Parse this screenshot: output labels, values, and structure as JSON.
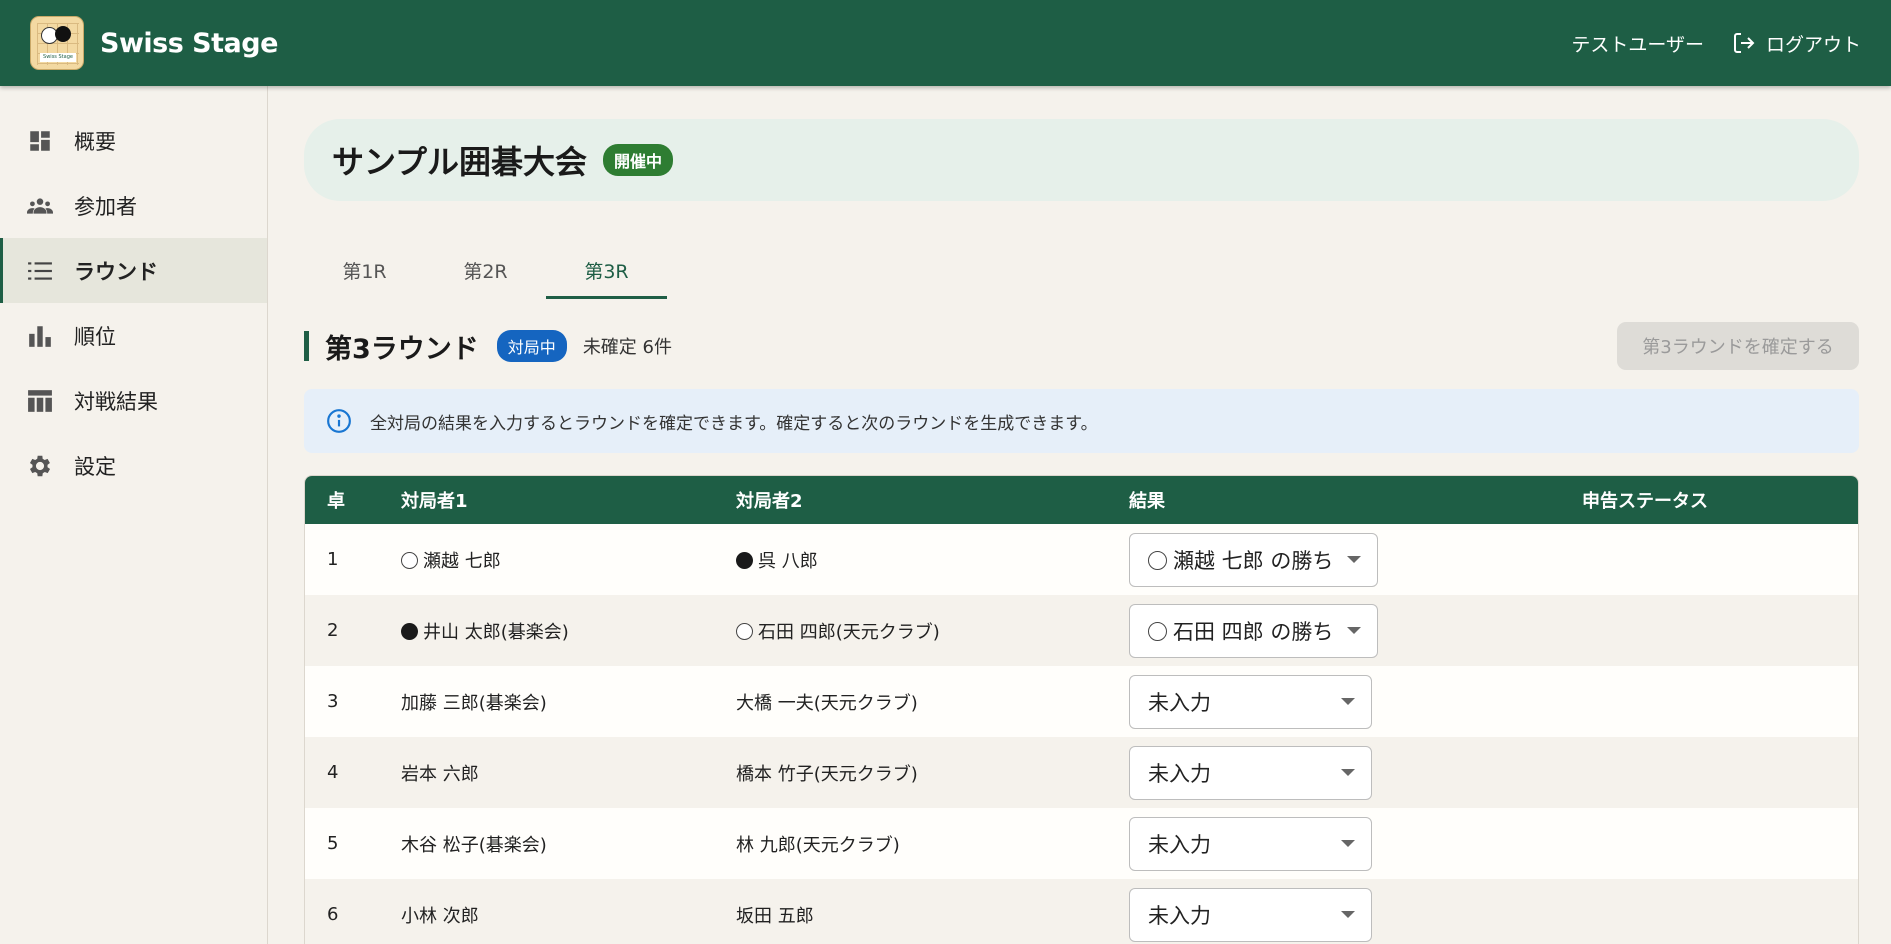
{
  "app": {
    "title": "Swiss Stage",
    "logo_text": "Swiss Stage"
  },
  "header": {
    "user_name": "テストユーザー",
    "logout_label": "ログアウト"
  },
  "sidebar": {
    "items": [
      {
        "label": "概要",
        "icon": "dashboard-icon"
      },
      {
        "label": "参加者",
        "icon": "people-icon"
      },
      {
        "label": "ラウンド",
        "icon": "list-icon",
        "active": true
      },
      {
        "label": "順位",
        "icon": "bar-chart-icon"
      },
      {
        "label": "対戦結果",
        "icon": "table-icon"
      },
      {
        "label": "設定",
        "icon": "gear-icon"
      }
    ]
  },
  "tournament": {
    "name": "サンプル囲碁大会",
    "status": "開催中"
  },
  "tabs": [
    {
      "label": "第1R"
    },
    {
      "label": "第2R"
    },
    {
      "label": "第3R",
      "active": true
    }
  ],
  "round": {
    "title": "第3ラウンド",
    "status": "対局中",
    "pending": "未確定 6件",
    "confirm_label": "第3ラウンドを確定する"
  },
  "info": {
    "message": "全対局の結果を入力するとラウンドを確定できます。確定すると次のラウンドを生成できます。"
  },
  "table": {
    "headers": {
      "table": "卓",
      "player1": "対局者1",
      "player2": "対局者2",
      "result": "結果",
      "status": "申告ステータス"
    },
    "rows": [
      {
        "table": "1",
        "player1": "瀬越 七郎",
        "p1_stone": "white",
        "player2": "呉 八郎",
        "p2_stone": "black",
        "result": "瀬越 七郎 の勝ち",
        "result_stone": "white"
      },
      {
        "table": "2",
        "player1": "井山 太郎(碁楽会)",
        "p1_stone": "black",
        "player2": "石田 四郎(天元クラブ)",
        "p2_stone": "white",
        "result": "石田 四郎 の勝ち",
        "result_stone": "white"
      },
      {
        "table": "3",
        "player1": "加藤 三郎(碁楽会)",
        "p1_stone": "",
        "player2": "大橋 一夫(天元クラブ)",
        "p2_stone": "",
        "result": "未入力",
        "result_stone": ""
      },
      {
        "table": "4",
        "player1": "岩本 六郎",
        "p1_stone": "",
        "player2": "橋本 竹子(天元クラブ)",
        "p2_stone": "",
        "result": "未入力",
        "result_stone": ""
      },
      {
        "table": "5",
        "player1": "木谷 松子(碁楽会)",
        "p1_stone": "",
        "player2": "林 九郎(天元クラブ)",
        "p2_stone": "",
        "result": "未入力",
        "result_stone": ""
      },
      {
        "table": "6",
        "player1": "小林 次郎",
        "p1_stone": "",
        "player2": "坂田 五郎",
        "p2_stone": "",
        "result": "未入力",
        "result_stone": ""
      }
    ]
  },
  "colors": {
    "primary": "#1e5e45",
    "open_chip": "#2e7d32",
    "playing_chip": "#1565c0",
    "info_bg": "#e6eff9"
  }
}
